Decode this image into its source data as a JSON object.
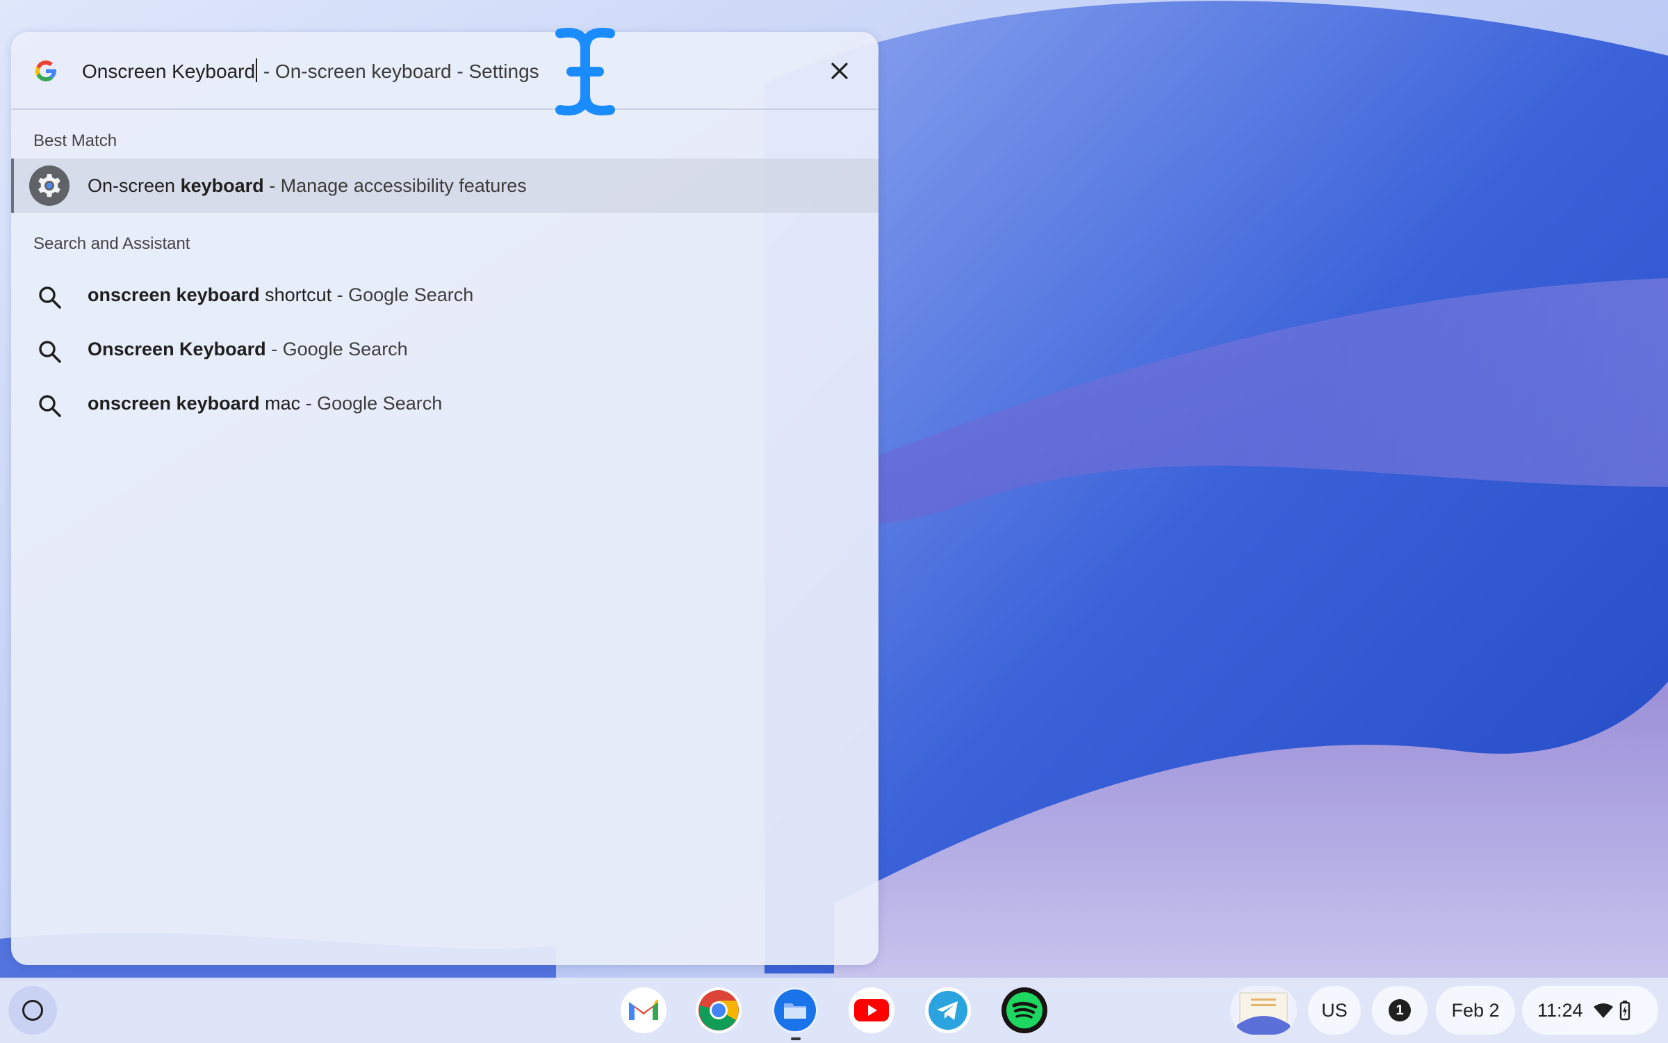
{
  "launcher": {
    "query_typed": "Onscreen Keyboard",
    "query_suggestion": " - On-screen keyboard - Settings",
    "best_match_label": "Best Match",
    "best_match": {
      "prefix": "On-screen ",
      "bold": "keyboard",
      "suffix": " - Manage accessibility features",
      "icon": "settings-gear-icon"
    },
    "search_section_label": "Search and Assistant",
    "search_results": [
      {
        "bold": "onscreen keyboard",
        "rest": " shortcut",
        "source": " - Google Search"
      },
      {
        "bold": "Onscreen Keyboard",
        "rest": "",
        "source": " - Google Search"
      },
      {
        "bold": "onscreen keyboard",
        "rest": " mac",
        "source": " - Google Search"
      }
    ]
  },
  "shelf": {
    "apps": [
      "Gmail",
      "Chrome",
      "Files",
      "YouTube",
      "Telegram",
      "Spotify"
    ],
    "ime": "US",
    "notification_count": "1",
    "date": "Feb 2",
    "time": "11:24"
  },
  "colors": {
    "accent": "#1a73e8",
    "cursor": "#1a8cff"
  }
}
